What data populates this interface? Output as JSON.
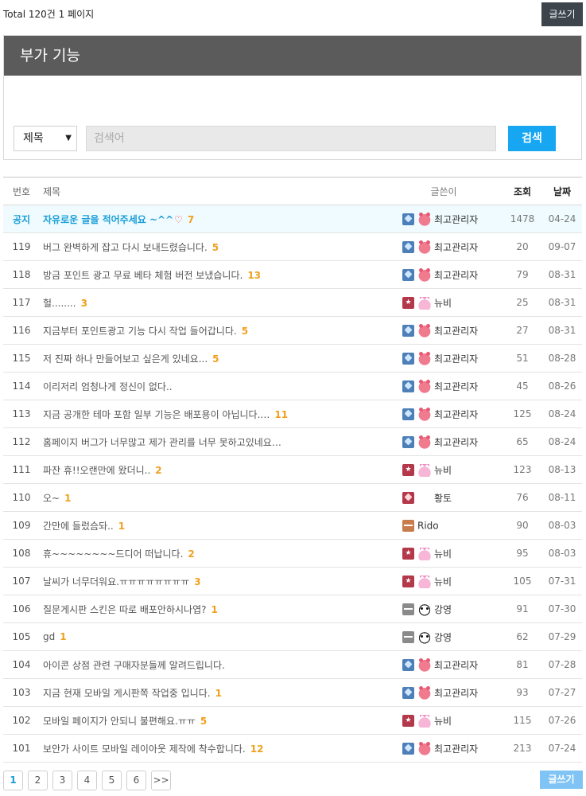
{
  "header": {
    "total": "Total 120건 1 페이지",
    "write_label": "글쓰기"
  },
  "panel": {
    "title": "부가 기능"
  },
  "search": {
    "select_value": "제목",
    "caret": "▼",
    "placeholder": "검색어",
    "button": "검색"
  },
  "table": {
    "columns": {
      "num": "번호",
      "title": "제목",
      "writer": "글쓴이",
      "views": "조회",
      "date": "날짜"
    },
    "rows": [
      {
        "num": "공지",
        "title": "자유로운 글을 적어주세요 ~^^",
        "heart": "♡",
        "comments": "7",
        "level": "blue",
        "avatar": "pig",
        "writer": "최고관리자",
        "views": "1478",
        "date": "04-24",
        "notice": true
      },
      {
        "num": "119",
        "title": "버그 완벽하게 잡고 다시 보내드렸습니다.",
        "comments": "5",
        "level": "blue",
        "avatar": "pig",
        "writer": "최고관리자",
        "views": "20",
        "date": "09-07"
      },
      {
        "num": "118",
        "title": "방금 포인트 광고 무료 베타 체험 버전 보냈습니다.",
        "comments": "13",
        "level": "blue",
        "avatar": "pig",
        "writer": "최고관리자",
        "views": "79",
        "date": "08-31"
      },
      {
        "num": "117",
        "title": "헐........",
        "comments": "3",
        "level": "red-star",
        "avatar": "crown",
        "writer": "뉴비",
        "views": "25",
        "date": "08-31"
      },
      {
        "num": "116",
        "title": "지금부터 포인트광고 기능 다시 작업 들어갑니다.",
        "comments": "5",
        "level": "blue",
        "avatar": "pig",
        "writer": "최고관리자",
        "views": "27",
        "date": "08-31"
      },
      {
        "num": "115",
        "title": "저 진짜 하나 만들어보고 싶은게 있네요...",
        "comments": "5",
        "level": "blue",
        "avatar": "pig",
        "writer": "최고관리자",
        "views": "51",
        "date": "08-28"
      },
      {
        "num": "114",
        "title": "이리저리 엄청나게 정신이 없다..",
        "comments": "",
        "level": "blue",
        "avatar": "pig",
        "writer": "최고관리자",
        "views": "45",
        "date": "08-26"
      },
      {
        "num": "113",
        "title": "지금 공개한 테마 포함 일부 기능은 배포용이 아닙니다.…",
        "comments": "11",
        "level": "blue",
        "avatar": "pig",
        "writer": "최고관리자",
        "views": "125",
        "date": "08-24"
      },
      {
        "num": "112",
        "title": "홈페이지 버그가 너무많고 제가 관리를 너무 못하고있네요…",
        "comments": "",
        "level": "blue",
        "avatar": "pig",
        "writer": "최고관리자",
        "views": "65",
        "date": "08-24"
      },
      {
        "num": "111",
        "title": "파잔 휴!!오랜만에 왔더니..",
        "comments": "2",
        "level": "red-star",
        "avatar": "crown",
        "writer": "뉴비",
        "views": "123",
        "date": "08-13"
      },
      {
        "num": "110",
        "title": "오~",
        "comments": "1",
        "level": "red-diamond",
        "avatar": "none",
        "writer": "황토",
        "views": "76",
        "date": "08-11"
      },
      {
        "num": "109",
        "title": "간만에 들렀슴돠..",
        "comments": "1",
        "level": "stripe",
        "avatar": "none-tight",
        "writer": "Rido",
        "views": "90",
        "date": "08-03"
      },
      {
        "num": "108",
        "title": "휴~~~~~~~~드디어 떠납니다.",
        "comments": "2",
        "level": "red-star",
        "avatar": "crown",
        "writer": "뉴비",
        "views": "95",
        "date": "08-03"
      },
      {
        "num": "107",
        "title": "날씨가 너무더워요.ㅠㅠㅠㅠㅠㅠㅠㅠ",
        "comments": "3",
        "level": "red-star",
        "avatar": "crown",
        "writer": "뉴비",
        "views": "105",
        "date": "07-31"
      },
      {
        "num": "106",
        "title": "질문게시판 스킨은 따로 배포안하시나엽?",
        "comments": "1",
        "level": "gray",
        "avatar": "panda",
        "writer": "강영",
        "views": "91",
        "date": "07-30"
      },
      {
        "num": "105",
        "title": "gd",
        "comments": "1",
        "level": "gray",
        "avatar": "panda",
        "writer": "강영",
        "views": "62",
        "date": "07-29"
      },
      {
        "num": "104",
        "title": "아이콘 상점 관련 구매자분들께 알려드립니다.",
        "comments": "",
        "level": "blue",
        "avatar": "pig",
        "writer": "최고관리자",
        "views": "81",
        "date": "07-28"
      },
      {
        "num": "103",
        "title": "지금 현재 모바일 게시판쪽 작업중 입니다.",
        "comments": "1",
        "level": "blue",
        "avatar": "pig",
        "writer": "최고관리자",
        "views": "93",
        "date": "07-27"
      },
      {
        "num": "102",
        "title": "모바일 페이지가 안되니 불편해요.ㅠㅠ",
        "comments": "5",
        "level": "red-star",
        "avatar": "crown",
        "writer": "뉴비",
        "views": "115",
        "date": "07-26"
      },
      {
        "num": "101",
        "title": "보안가 사이트 모바일 레이아웃 제작에 착수합니다.",
        "comments": "12",
        "level": "blue",
        "avatar": "pig",
        "writer": "최고관리자",
        "views": "213",
        "date": "07-24"
      }
    ]
  },
  "pagination": {
    "pages": [
      "1",
      "2",
      "3",
      "4",
      "5",
      "6"
    ],
    "next": ">>",
    "active": "1"
  },
  "footer": {
    "write_label": "글쓰기"
  },
  "colors": {
    "accent": "#17a6f1",
    "notice": "#1a9fd8",
    "comment": "#f0a01e",
    "header_bg": "#5b5b5b",
    "dark_button": "#3d444c"
  }
}
